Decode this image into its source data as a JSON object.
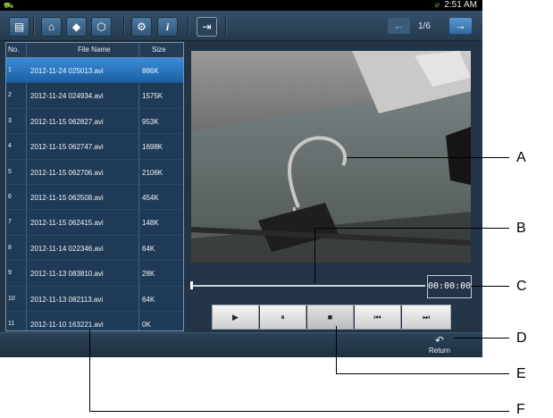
{
  "status": {
    "time": "2:51 AM"
  },
  "pager": {
    "text": "1/6"
  },
  "file_list": {
    "headers": {
      "no": "No.",
      "name": "File Name",
      "size": "Size"
    },
    "rows": [
      {
        "no": "1",
        "name": "2012-11-24 025013.avi",
        "size": "886K",
        "selected": true
      },
      {
        "no": "2",
        "name": "2012-11-24 024934.avi",
        "size": "1575K"
      },
      {
        "no": "3",
        "name": "2012-11-15 062827.avi",
        "size": "953K"
      },
      {
        "no": "4",
        "name": "2012-11-15 062747.avi",
        "size": "1698K"
      },
      {
        "no": "5",
        "name": "2012-11-15 062706.avi",
        "size": "2106K"
      },
      {
        "no": "6",
        "name": "2012-11-15 062508.avi",
        "size": "454K"
      },
      {
        "no": "7",
        "name": "2012-11-15 062415.avi",
        "size": "148K"
      },
      {
        "no": "8",
        "name": "2012-11-14 022346.avi",
        "size": "64K"
      },
      {
        "no": "9",
        "name": "2012-11-13 083810.avi",
        "size": "28K"
      },
      {
        "no": "10",
        "name": "2012-11-13 082113.avi",
        "size": "64K"
      },
      {
        "no": "11",
        "name": "2012-11-10 163221.avi",
        "size": "0K"
      }
    ]
  },
  "playback": {
    "timecode": "00:00:00"
  },
  "bottom": {
    "return_label": "Return"
  },
  "callouts": [
    "A",
    "B",
    "C",
    "D",
    "E",
    "F"
  ],
  "icons": [
    "menu-icon",
    "home-icon",
    "tag-icon",
    "shield-icon",
    "settings-icon",
    "info-icon",
    "exit-icon",
    "prev-page-icon",
    "next-page-icon",
    "play-icon",
    "pause-icon",
    "stop-icon",
    "rewind-icon",
    "fast-forward-icon",
    "return-icon"
  ],
  "colors": {
    "screen_bg": "#223445",
    "selected_row": "#2f7bc4",
    "toolbar": "#2d4660"
  }
}
